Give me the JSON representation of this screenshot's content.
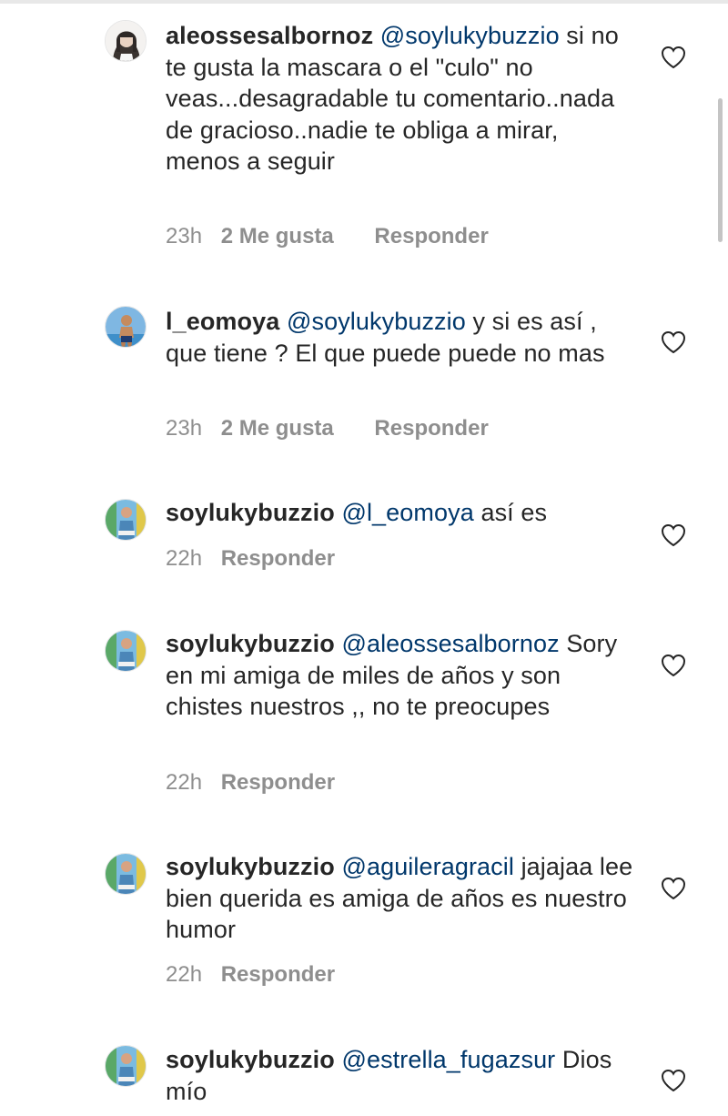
{
  "comments": [
    {
      "username": "aleossesalbornoz",
      "mention": "@soylukybuzzio",
      "text": "si no te gusta la mascara o el \"culo\" no veas...desagradable tu comentario..nada de gracioso..nadie te obliga a mirar, menos a seguir",
      "time": "23h",
      "likes": "2 Me gusta",
      "reply": "Responder"
    },
    {
      "username": "l_eomoya",
      "mention": "@soylukybuzzio",
      "text": "y si es así , que tiene ? El que puede puede no mas",
      "time": "23h",
      "likes": "2 Me gusta",
      "reply": "Responder"
    },
    {
      "username": "soylukybuzzio",
      "mention": "@l_eomoya",
      "text": "así es",
      "time": "22h",
      "reply": "Responder"
    },
    {
      "username": "soylukybuzzio",
      "mention": "@aleossesalbornoz",
      "text": "Sory en mi amiga de miles de años y son chistes nuestros ,, no te preocupes",
      "time": "22h",
      "reply": "Responder"
    },
    {
      "username": "soylukybuzzio",
      "mention": "@aguileragracil",
      "text": "jajajaa lee bien querida es amiga de años es nuestro humor",
      "time": "22h",
      "reply": "Responder"
    },
    {
      "username": "soylukybuzzio",
      "mention": "@estrella_fugazsur",
      "text": "Dios mío"
    }
  ],
  "icons": {
    "like": "heart-outline-icon"
  },
  "colors": {
    "text": "#262626",
    "mention": "#00376b",
    "meta": "#8e8e8e"
  }
}
